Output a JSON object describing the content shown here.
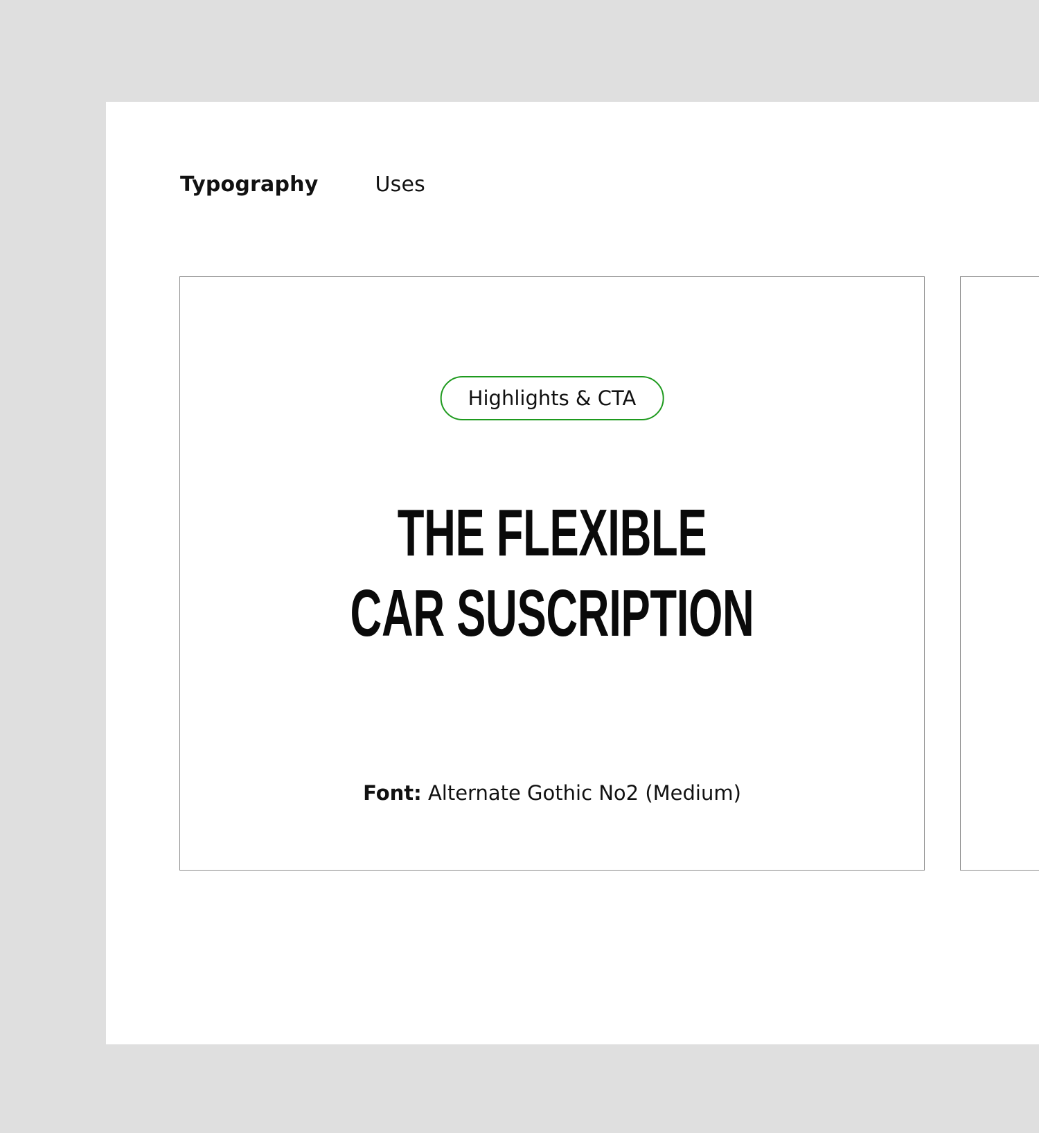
{
  "tabs": [
    {
      "label": "Typography",
      "active": true
    },
    {
      "label": "Uses",
      "active": false
    }
  ],
  "card": {
    "tag": "Highlights & CTA",
    "tag_color": "#1e9a1e",
    "headline_line1": "THE FLEXIBLE",
    "headline_line2": "CAR SUSCRIPTION",
    "font_label": "Font:",
    "font_value": " Alternate Gothic No2 (Medium)"
  },
  "colors": {
    "background": "#dfdfdf",
    "sheet": "#ffffff",
    "card_border": "#8a8a8a"
  }
}
